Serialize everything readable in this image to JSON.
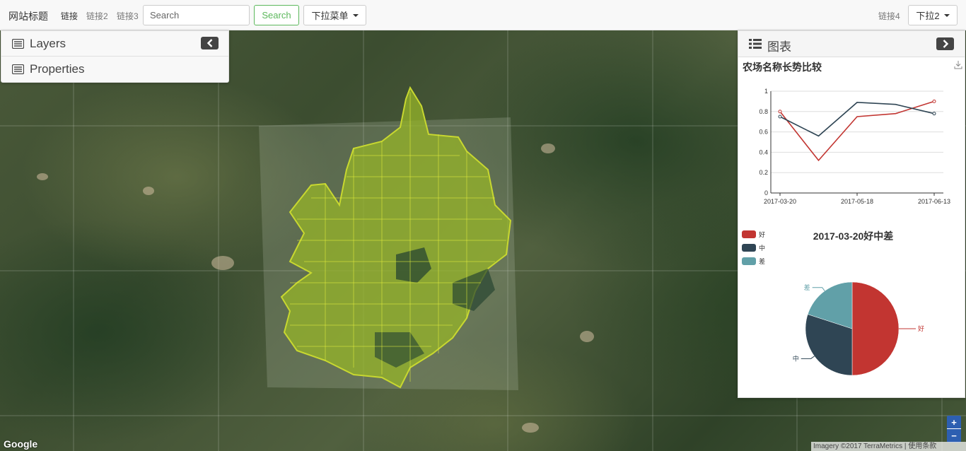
{
  "navbar": {
    "brand": "网站标题",
    "link1": "链接",
    "link2": "链接2",
    "link3": "链接3",
    "search_placeholder": "Search",
    "search_button": "Search",
    "dropdown1": "下拉菜单",
    "link4": "链接4",
    "dropdown2": "下拉2"
  },
  "left_panel": {
    "layers_label": "Layers",
    "properties_label": "Properties",
    "layers_icon": "list-icon",
    "properties_icon": "list-icon",
    "collapse_icon": "chevron-left-icon"
  },
  "right_panel": {
    "title": "图表",
    "header_icon": "chart-list-icon",
    "collapse_icon": "chevron-right-icon",
    "download_icon": "download-icon"
  },
  "map": {
    "google_logo": "Google",
    "attribution": "Imagery ©2017 TerraMetrics | 使用条款",
    "zoom_in": "+",
    "zoom_out": "−"
  },
  "chart_data": [
    {
      "type": "line",
      "title": "农场名称长势比较",
      "x": [
        "2017-03-20",
        "2017-04-18",
        "2017-05-18",
        "2017-06-01",
        "2017-06-13"
      ],
      "x_tick_labels": [
        "2017-03-20",
        "2017-05-18",
        "2017-06-13"
      ],
      "ylim": [
        0,
        1
      ],
      "y_ticks": [
        "0",
        "0.2",
        "0.4",
        "0.6",
        "0.8",
        "1"
      ],
      "grid": true,
      "series": [
        {
          "color": "#c23531",
          "values": [
            0.8,
            0.32,
            0.75,
            0.78,
            0.9
          ]
        },
        {
          "color": "#2f4554",
          "values": [
            0.75,
            0.56,
            0.89,
            0.87,
            0.78
          ]
        }
      ]
    },
    {
      "type": "pie",
      "title": "2017-03-20好中差",
      "legend_position": "top-left",
      "slices": [
        {
          "label": "好",
          "value": 50,
          "color": "#c23531"
        },
        {
          "label": "中",
          "value": 30,
          "color": "#2f4554"
        },
        {
          "label": "差",
          "value": 20,
          "color": "#61a0a8"
        }
      ]
    }
  ]
}
